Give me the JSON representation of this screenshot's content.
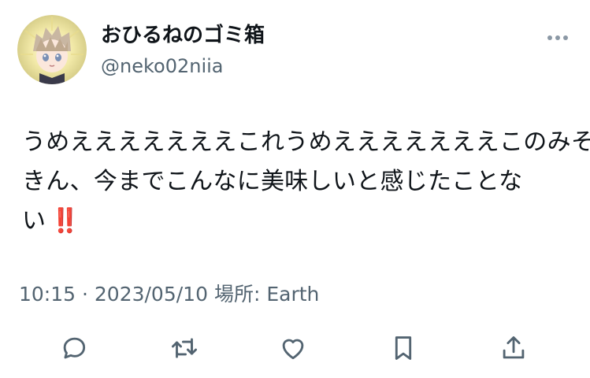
{
  "tweet": {
    "author": {
      "display_name": "おひるねのゴミ箱",
      "handle": "@neko02niia"
    },
    "text_lines": [
      "うめえええええええこれうめえええええええこのみそ",
      "きん、今までこんなに美味しいと感じたことな",
      "い"
    ],
    "emoji": "‼️",
    "timestamp": "10:15 · 2023/05/10",
    "location_label": "場所:",
    "location": "Earth"
  },
  "icons": {
    "more": "more-horizontal-icon",
    "reply": "speech-bubble-icon",
    "retweet": "retweet-icon",
    "like": "heart-icon",
    "bookmark": "bookmark-icon",
    "share": "share-upload-icon"
  },
  "colors": {
    "text": "#0f1419",
    "secondary": "#536471",
    "emoji_red": "#dd2e44"
  }
}
